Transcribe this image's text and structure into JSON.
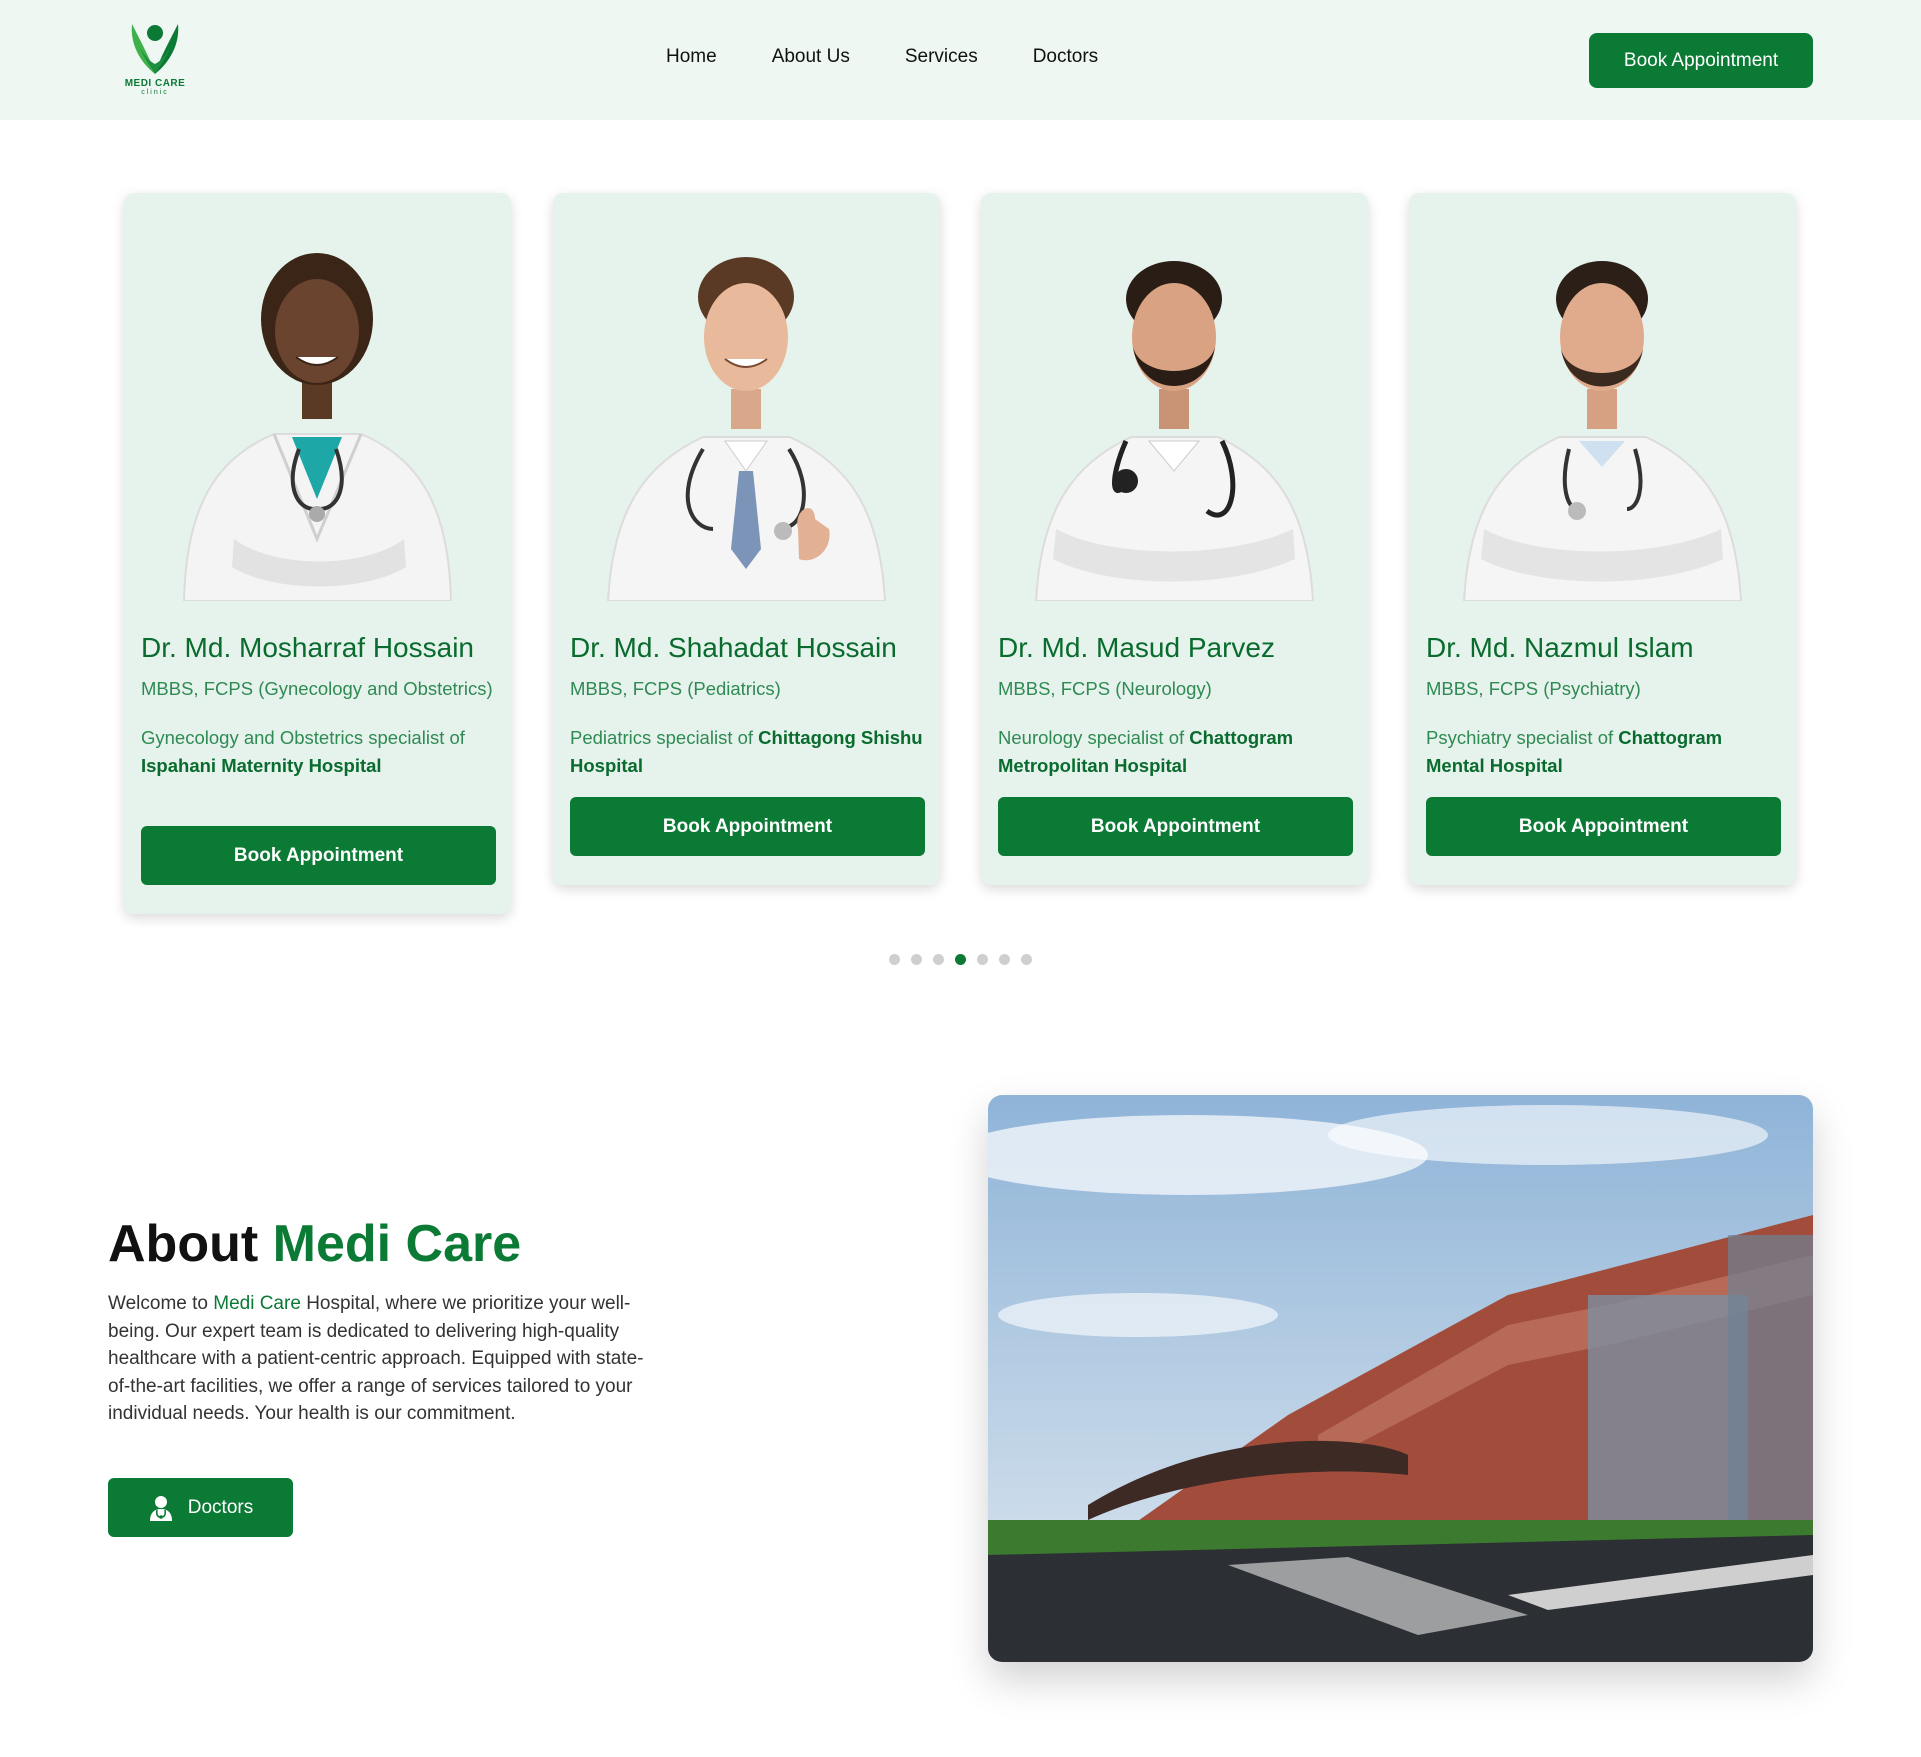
{
  "brand": {
    "name": "MEDI CARE",
    "tagline": "clinic",
    "color": "#0a7a35"
  },
  "nav": {
    "links": [
      "Home",
      "About Us",
      "Services",
      "Doctors"
    ],
    "cta_label": "Book Appointment"
  },
  "doctors": [
    {
      "name": "Dr. Md. Mosharraf Hossain",
      "qualification": "MBBS, FCPS (Gynecology and Obstetrics)",
      "specialty": "Gynecology and Obstetrics specialist of",
      "hospital": "Ispahani Maternity Hospital",
      "button": "Book Appointment"
    },
    {
      "name": "Dr. Md. Shahadat Hossain",
      "qualification": "MBBS, FCPS (Pediatrics)",
      "specialty": "Pediatrics specialist of",
      "hospital": "Chittagong Shishu Hospital",
      "button": "Book Appointment"
    },
    {
      "name": "Dr. Md. Masud Parvez",
      "qualification": "MBBS, FCPS (Neurology)",
      "specialty": "Neurology specialist of",
      "hospital": "Chattogram Metropolitan Hospital",
      "button": "Book Appointment"
    },
    {
      "name": "Dr. Md. Nazmul Islam",
      "qualification": "MBBS, FCPS (Psychiatry)",
      "specialty": "Psychiatry specialist of",
      "hospital": "Chattogram Mental Hospital",
      "button": "Book Appointment"
    }
  ],
  "carousel": {
    "total_pages": 7,
    "active_page": 4
  },
  "about": {
    "title_plain": "About",
    "title_accent": "Medi Care",
    "text_before": "Welcome to",
    "text_highlight": "Medi Care",
    "text_after": "Hospital, where we prioritize your well-being. Our expert team is dedicated to delivering high-quality healthcare with a patient-centric approach. Equipped with state-of-the-art facilities, we offer a range of services tailored to your individual needs. Your health is our commitment.",
    "button_label": "Doctors",
    "button_icon": "doctor-icon"
  },
  "colors": {
    "primary": "#0a7a35",
    "header_bg": "#eef7f1",
    "card_bg": "#e6f3ec",
    "dot_inactive": "#cfcfcf"
  }
}
